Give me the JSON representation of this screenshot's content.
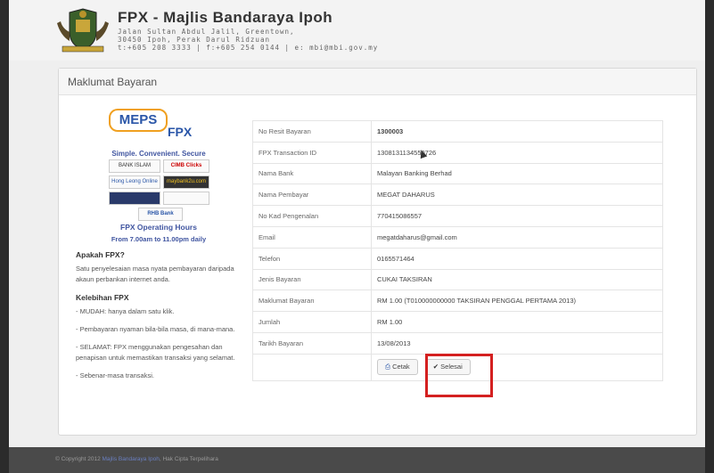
{
  "header": {
    "title": "FPX - Majlis Bandaraya Ipoh",
    "address_line1": "Jalan Sultan Abdul Jalil, Greentown,",
    "address_line2": "30450 Ipoh, Perak Darul Ridzuan",
    "contact_line": "t:+605 208 3333 | f:+605 254 0144 | e: mbi@mbi.gov.my"
  },
  "panel": {
    "title": "Maklumat Bayaran"
  },
  "sidebar": {
    "meps_label": "MEPS",
    "fpx_label": "FPX",
    "tagline": "Simple. Convenient. Secure",
    "banks": [
      "BANK ISLAM",
      "CIMB Clicks",
      "Hong Leong Online",
      "maybank2u.com",
      "RHB Bank"
    ],
    "hours_title": "FPX Operating Hours",
    "hours_detail": "From 7.00am to 11.00pm daily",
    "what_heading": "Apakah FPX?",
    "what_text": "Satu penyelesaian masa nyata pembayaran daripada akaun perbankan internet anda.",
    "benefits_heading": "Kelebihan FPX",
    "benefits": [
      "- MUDAH: hanya dalam satu klik.",
      "- Pembayaran nyaman bila-bila masa, di mana-mana.",
      "- SELAMAT: FPX menggunakan pengesahan dan penapisan untuk memastikan transaksi yang selamat.",
      "- Sebenar-masa transaksi."
    ]
  },
  "details": {
    "rows": [
      {
        "label": "No Resit Bayaran",
        "value": "1300003"
      },
      {
        "label": "FPX Transaction ID",
        "value": "1308131134550726"
      },
      {
        "label": "Nama Bank",
        "value": "Malayan Banking Berhad"
      },
      {
        "label": "Nama Pembayar",
        "value": "MEGAT DAHARUS"
      },
      {
        "label": "No Kad Pengenalan",
        "value": "770415086557"
      },
      {
        "label": "Email",
        "value": "megatdaharus@gmail.com"
      },
      {
        "label": "Telefon",
        "value": "0165571464"
      },
      {
        "label": "Jenis Bayaran",
        "value": "CUKAI TAKSIRAN"
      },
      {
        "label": "Maklumat Bayaran",
        "value": "RM 1.00 (T010000000000 TAKSIRAN PENGGAL PERTAMA 2013)"
      },
      {
        "label": "Jumlah",
        "value": "RM 1.00"
      },
      {
        "label": "Tarikh Bayaran",
        "value": "13/08/2013"
      }
    ],
    "print_label": "Cetak",
    "done_label": "Selesai"
  },
  "footer": {
    "copyright": "© Copyright 2012",
    "link_text": "Majlis Bandaraya Ipoh",
    "rights": "Hak Cipta Terpelihara"
  },
  "colors": {
    "accent_blue": "#2a56a8",
    "highlight_red": "#d42020",
    "footer_bg": "#4a4a4a"
  }
}
